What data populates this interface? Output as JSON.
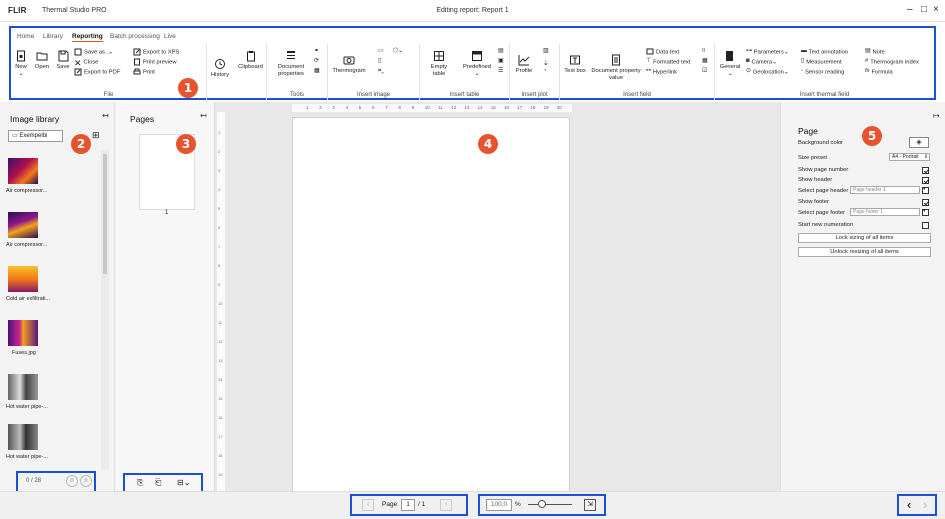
{
  "app": {
    "logo": "FLIR",
    "name": "Thermal Studio PRO",
    "document_title": "Editing report: Report 1",
    "window_controls": [
      "–",
      "□",
      "×"
    ]
  },
  "ribbon": {
    "tabs": [
      "Home",
      "Library",
      "Reporting",
      "Batch processing",
      "Live"
    ],
    "active_tab": "Reporting",
    "groups": {
      "file": {
        "label": "File",
        "buttons": [
          "New",
          "Open",
          "Save"
        ],
        "small": [
          "Save as..",
          "Close",
          "Export to PDF",
          "Export to XPS",
          "Print preview",
          "Print"
        ]
      },
      "history": {
        "label": "History"
      },
      "clipboard": {
        "label": "Clipboard"
      },
      "tools": {
        "label": "Tools",
        "buttons": [
          "Document properties"
        ]
      },
      "insert_image": {
        "label": "Insert image",
        "buttons": [
          "Thermogram"
        ]
      },
      "insert_table": {
        "label": "Insert table",
        "buttons": [
          "Empty table",
          "Predefined"
        ]
      },
      "insert_plot": {
        "label": "Insert plot",
        "buttons": [
          "Profile"
        ]
      },
      "insert_field": {
        "label": "Insert field",
        "buttons": [
          "Text box",
          "Document property value"
        ],
        "small": [
          "Data text",
          "Formatted text",
          "Hyperlink"
        ]
      },
      "insert_thermal_field": {
        "label": "Insert thermal field",
        "buttons": [
          "General"
        ],
        "small": [
          "Parameters",
          "Camera",
          "Geolocation",
          "Text annotation",
          "Measurement",
          "Sensor reading",
          "Note",
          "Thermogram index",
          "Formula"
        ]
      }
    }
  },
  "image_library": {
    "title": "Image library",
    "folder": "Exempelbi",
    "items": [
      {
        "label": "Air compressor..."
      },
      {
        "label": "Air compressor..."
      },
      {
        "label": "Cold air exfiltrati..."
      },
      {
        "label": "Fuses.jpg"
      },
      {
        "label": "Hot water pipe-..."
      },
      {
        "label": "Hot water pipe-..."
      }
    ],
    "counter": "0 / 28"
  },
  "pages_panel": {
    "title": "Pages",
    "page_number": "1"
  },
  "ruler": {
    "top_ticks": [
      "1",
      "2",
      "3",
      "4",
      "5",
      "6",
      "7",
      "8",
      "9",
      "10",
      "11",
      "12",
      "13",
      "14",
      "15",
      "16",
      "17",
      "18",
      "19",
      "20"
    ],
    "left_ticks": [
      "1",
      "2",
      "3",
      "4",
      "5",
      "6",
      "7",
      "8",
      "9",
      "10",
      "11",
      "12",
      "13",
      "14",
      "15",
      "16",
      "17",
      "18",
      "19"
    ]
  },
  "page_properties": {
    "title": "Page",
    "background_color_label": "Background color",
    "size_preset_label": "Size preset",
    "size_preset_value": "A4 - Portrait",
    "show_page_number_label": "Show page number",
    "show_header_label": "Show header",
    "select_page_header_label": "Select page header",
    "select_page_header_placeholder": "Page header 1",
    "show_footer_label": "Show footer",
    "select_page_footer_label": "Select page footer",
    "select_page_footer_placeholder": "Page footer 1",
    "start_new_numeration_label": "Start new numeration",
    "lock_sizing_label": "Lock sizing of all items",
    "unlock_resizing_label": "Unlock resizing of all items"
  },
  "navigation": {
    "page_label": "Page",
    "page_value": "1",
    "page_total": "/ 1",
    "zoom_value": "100,0",
    "zoom_unit": "%"
  },
  "callouts": [
    "1",
    "2",
    "3",
    "4",
    "5"
  ],
  "colors": {
    "highlight": "#1a4fd6",
    "callout": "#e8532f",
    "active_tab_underline": "#dd5522"
  }
}
